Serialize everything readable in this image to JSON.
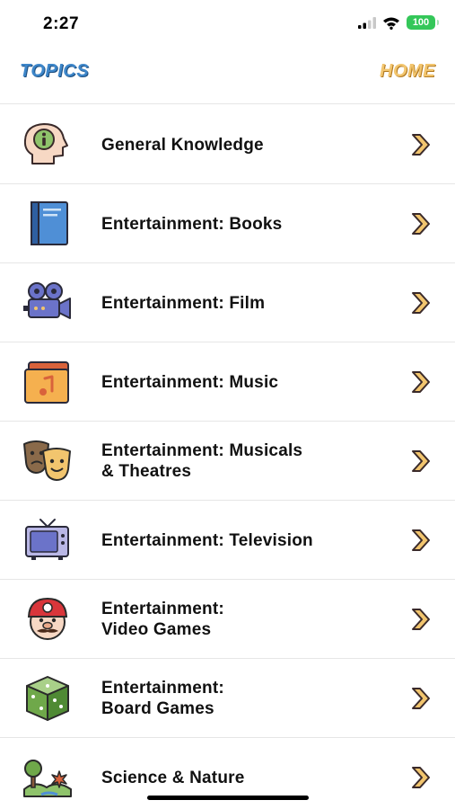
{
  "status_bar": {
    "time": "2:27",
    "battery": "100",
    "icons": [
      "signal-icon",
      "wifi-icon",
      "battery-icon"
    ]
  },
  "nav": {
    "left": "TOPICS",
    "right": "HOME"
  },
  "colors": {
    "nav_left": "#3d86c9",
    "nav_right": "#f2c56e",
    "chevron": "#f2c56e",
    "battery": "#34c759"
  },
  "topics": [
    {
      "label": "General Knowledge",
      "icon": "head-info-icon"
    },
    {
      "label": "Entertainment: Books",
      "icon": "book-icon"
    },
    {
      "label": "Entertainment: Film",
      "icon": "film-camera-icon"
    },
    {
      "label": "Entertainment: Music",
      "icon": "music-folder-icon"
    },
    {
      "label": "Entertainment: Musicals\n& Theatres",
      "icon": "theatre-masks-icon"
    },
    {
      "label": "Entertainment: Television",
      "icon": "television-icon"
    },
    {
      "label": "Entertainment:\nVideo Games",
      "icon": "mario-icon"
    },
    {
      "label": "Entertainment:\nBoard Games",
      "icon": "dice-icon"
    },
    {
      "label": "Science & Nature",
      "icon": "nature-icon"
    }
  ]
}
